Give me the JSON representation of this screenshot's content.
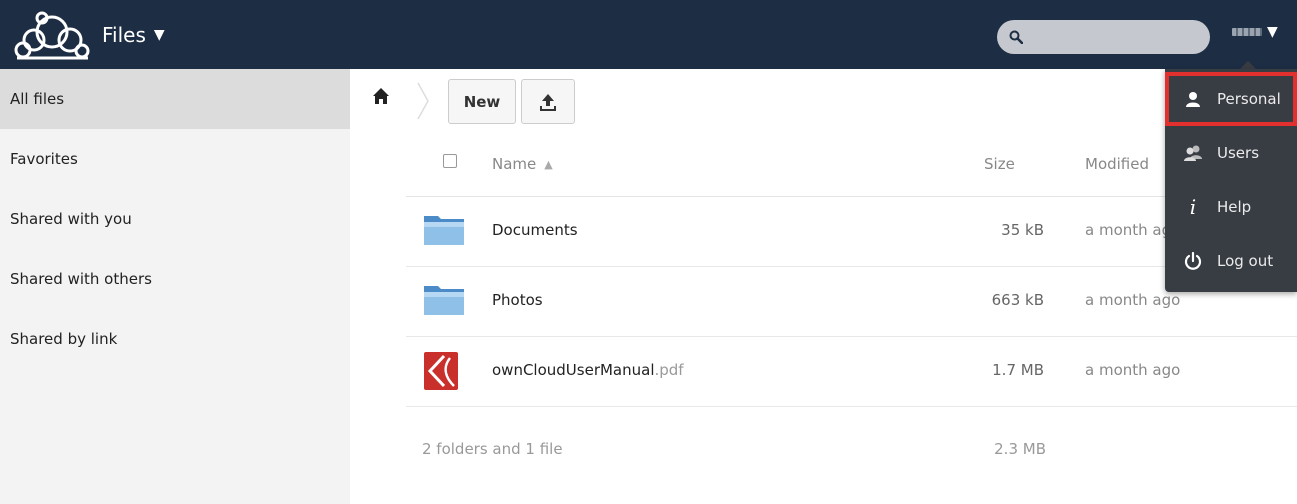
{
  "header": {
    "app_name": "Files",
    "search_placeholder": "",
    "user_name_blurred": true
  },
  "sidebar": {
    "items": [
      {
        "label": "All files",
        "active": true
      },
      {
        "label": "Favorites"
      },
      {
        "label": "Shared with you"
      },
      {
        "label": "Shared with others"
      },
      {
        "label": "Shared by link"
      }
    ]
  },
  "toolbar": {
    "new_label": "New"
  },
  "table": {
    "columns": {
      "name": "Name",
      "sort_indicator": "▲",
      "size": "Size",
      "modified": "Modified"
    },
    "rows": [
      {
        "name": "Documents",
        "ext": "",
        "type": "folder",
        "size": "35 kB",
        "modified": "a month ago"
      },
      {
        "name": "Photos",
        "ext": "",
        "type": "folder",
        "size": "663 kB",
        "modified": "a month ago"
      },
      {
        "name": "ownCloudUserManual",
        "ext": ".pdf",
        "type": "pdf",
        "size": "1.7 MB",
        "modified": "a month ago"
      }
    ],
    "summary": {
      "text": "2 folders and 1 file",
      "size": "2.3 MB"
    }
  },
  "user_menu": {
    "items": [
      {
        "label": "Personal",
        "icon": "person-icon",
        "highlighted": true
      },
      {
        "label": "Users",
        "icon": "users-icon"
      },
      {
        "label": "Help",
        "icon": "info-icon"
      },
      {
        "label": "Log out",
        "icon": "power-icon"
      }
    ]
  },
  "colors": {
    "header_bg": "#1d2d44",
    "dropdown_bg": "#383c43",
    "highlight_border": "#e2302f",
    "folder_blue": "#6ea9d9",
    "pdf_red": "#c9302c"
  }
}
